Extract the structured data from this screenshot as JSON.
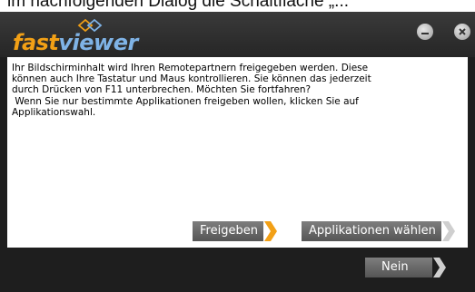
{
  "page_caption": "im nachfolgenden Dialog die Schaltfläche „...",
  "app": {
    "logo_part1": "fast",
    "logo_part2": "viewer",
    "brand_orange": "#f2a016",
    "brand_blue": "#7fb3e6"
  },
  "title_controls": {
    "minimize_icon": "minimize-icon",
    "close_icon": "close-icon"
  },
  "message": {
    "paragraph1": "Ihr Bildschirminhalt wird Ihren Remotepartnern freigegeben werden. Diese\nkönnen auch Ihre Tastatur und Maus kontrollieren. Sie können das jederzeit\ndurch Drücken von F11 unterbrechen. Möchten Sie fortfahren?",
    "paragraph2": " Wenn Sie nur bestimmte Applikationen freigeben wollen, klicken Sie auf\nApplikationswahl."
  },
  "buttons": {
    "share": "Freigeben",
    "choose_apps": "Applikationen wählen",
    "no": "Nein",
    "arrow_active": "#f2a016",
    "arrow_default": "#cfcfcf"
  }
}
